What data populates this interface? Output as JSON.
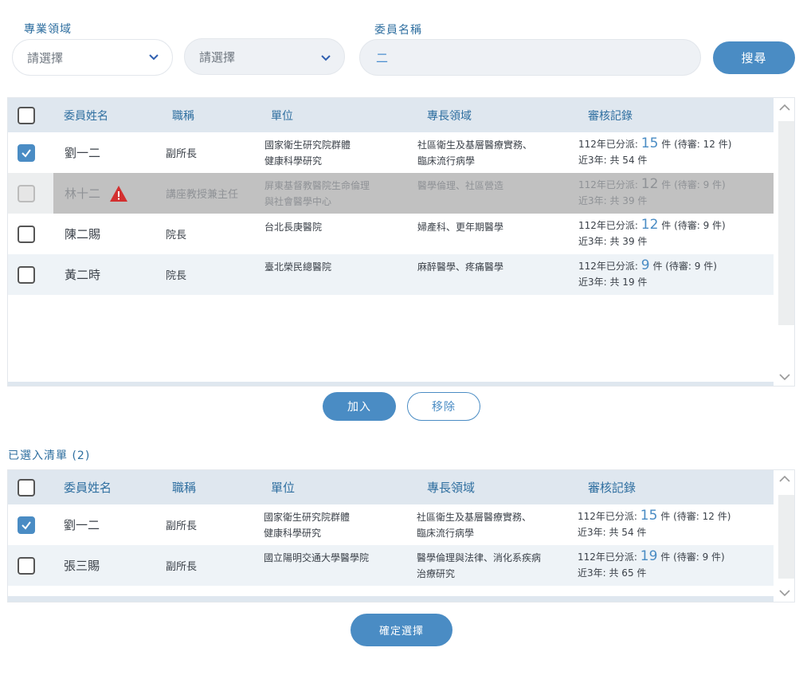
{
  "filters": {
    "specialty_label": "專業領域",
    "select1_text": "請選擇",
    "select2_text": "請選擇",
    "member_name_label": "委員名稱",
    "member_name_value": "二",
    "search_label": "搜尋"
  },
  "columns": {
    "name": "委員姓名",
    "title": "職稱",
    "unit": "單位",
    "expertise": "專長領域",
    "record": "審核記錄"
  },
  "results": [
    {
      "checked": true,
      "disabled": false,
      "warning": false,
      "name": "劉一二",
      "title": "副所長",
      "unit_line1": "國家衛生研究院群體",
      "unit_line2": "健康科學研究",
      "exp_line1": "社區衛生及基層醫療實務、",
      "exp_line2": "臨床流行病學",
      "assigned_prefix": "112年已分派:",
      "assigned_count": "15",
      "assigned_suffix": "件 (待審: 12 件)",
      "three_year": "近3年: 共 54 件"
    },
    {
      "checked": false,
      "disabled": true,
      "warning": true,
      "name": "林十二",
      "title": "講座教授兼主任",
      "unit_line1": "屏東基督教醫院生命倫理",
      "unit_line2": "與社會醫學中心",
      "exp_line1": "醫學倫理、社區營造",
      "exp_line2": "",
      "assigned_prefix": "112年已分派:",
      "assigned_count": "12",
      "assigned_suffix": "件 (待審: 9 件)",
      "three_year": "近3年: 共 39 件"
    },
    {
      "checked": false,
      "disabled": false,
      "warning": false,
      "name": "陳二賜",
      "title": "院長",
      "unit_line1": "台北長庚醫院",
      "unit_line2": "",
      "exp_line1": "婦產科、更年期醫學",
      "exp_line2": "",
      "assigned_prefix": "112年已分派:",
      "assigned_count": "12",
      "assigned_suffix": "件 (待審: 9 件)",
      "three_year": "近3年: 共 39 件"
    },
    {
      "checked": false,
      "disabled": false,
      "warning": false,
      "name": "黃二時",
      "title": "院長",
      "unit_line1": "臺北榮民總醫院",
      "unit_line2": "",
      "exp_line1": "麻醉醫學、疼痛醫學",
      "exp_line2": "",
      "assigned_prefix": "112年已分派:",
      "assigned_count": "9",
      "assigned_suffix": "件 (待審: 9 件)",
      "three_year": "近3年: 共 19 件"
    }
  ],
  "actions": {
    "add_label": "加入",
    "remove_label": "移除"
  },
  "selected_list": {
    "heading": "已選入清單 (2)",
    "rows": [
      {
        "checked": true,
        "name": "劉一二",
        "title": "副所長",
        "unit_line1": "國家衛生研究院群體",
        "unit_line2": "健康科學研究",
        "exp_line1": "社區衛生及基層醫療實務、",
        "exp_line2": "臨床流行病學",
        "assigned_prefix": "112年已分派:",
        "assigned_count": "15",
        "assigned_suffix": "件 (待審: 12 件)",
        "three_year": "近3年: 共 54 件"
      },
      {
        "checked": false,
        "name": "張三賜",
        "title": "副所長",
        "unit_line1": "國立陽明交通大學醫學院",
        "unit_line2": "",
        "exp_line1": "醫學倫理與法律、消化系疾病",
        "exp_line2": "治療研究",
        "assigned_prefix": "112年已分派:",
        "assigned_count": "19",
        "assigned_suffix": "件 (待審: 9 件)",
        "three_year": "近3年: 共 65 件"
      }
    ]
  },
  "confirm_label": "確定選擇",
  "colors": {
    "accent": "#4a8cc4",
    "header_bg": "#dfe7ef",
    "warning": "#d32f2f"
  },
  "icons": [
    "chevron-down-icon",
    "check-icon",
    "warning-triangle-icon",
    "chevron-up-icon"
  ]
}
